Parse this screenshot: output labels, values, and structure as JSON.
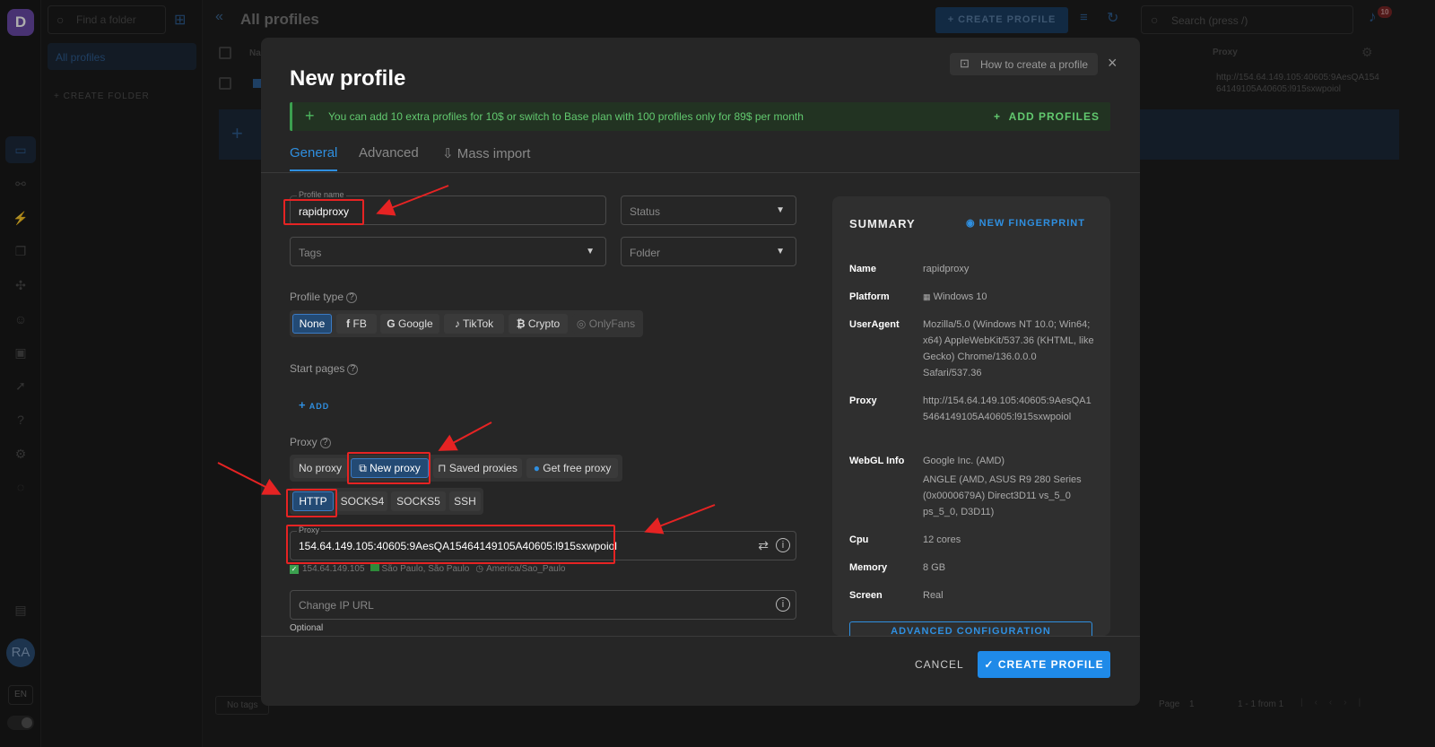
{
  "app": {
    "logo": "D",
    "title": "All profiles",
    "back_icon": "double-chevron-left-icon"
  },
  "rail": {
    "avatar": "RA",
    "language": "EN",
    "icons": [
      "profiles-icon",
      "link-icon",
      "automation-icon",
      "copy-icon",
      "extensions-icon",
      "team-icon",
      "api-icon",
      "launch-icon",
      "help-icon",
      "settings-icon",
      "bulb-icon",
      "wallet-icon",
      "theme-toggle-icon"
    ]
  },
  "folders": {
    "search_placeholder": "Find a folder",
    "all_profiles": "All profiles",
    "create_folder": "+ CREATE FOLDER"
  },
  "topbar": {
    "create_profile": "+ CREATE PROFILE",
    "search_placeholder": "Search (press /)",
    "notifications": "10"
  },
  "table": {
    "col_name": "Na",
    "col_proxy": "Proxy",
    "row_proxy": "http://154.64.149.105:40605:9AesQA15464149105A40605:l915sxwpoiol",
    "footer": {
      "no_tags": "No tags",
      "page_label": "Page",
      "page": "1",
      "range": "1 - 1 from 1"
    }
  },
  "modal": {
    "title": "New profile",
    "how_to": "How to create a profile",
    "banner": {
      "text": "You can add 10 extra profiles for 10$ or switch to Base plan with 100 profiles only for 89$ per month",
      "action": "ADD PROFILES"
    },
    "tabs": [
      "General",
      "Advanced",
      "Mass import"
    ],
    "fields": {
      "profile_name_label": "Profile name",
      "profile_name": "rapidproxy",
      "status": "Status",
      "tags": "Tags",
      "folder": "Folder"
    },
    "profile_type": {
      "label": "Profile type",
      "options": [
        "None",
        "FB",
        "Google",
        "TikTok",
        "Crypto",
        "OnlyFans"
      ],
      "selected": "None"
    },
    "start_pages": {
      "label": "Start pages",
      "add": "ADD"
    },
    "proxy": {
      "label": "Proxy",
      "modes": [
        "No proxy",
        "New proxy",
        "Saved proxies",
        "Get free proxy"
      ],
      "selected_mode": "New proxy",
      "protocols": [
        "HTTP",
        "SOCKS4",
        "SOCKS5",
        "SSH"
      ],
      "selected_protocol": "HTTP",
      "input_label": "Proxy",
      "value": "154.64.149.105:40605:9AesQA15464149105A40605:l915sxwpoiol",
      "ip": "154.64.149.105",
      "location": "São Paulo, São Paulo",
      "timezone": "America/Sao_Paulo",
      "change_ip_placeholder": "Change IP URL",
      "optional": "Optional"
    },
    "summary": {
      "title": "SUMMARY",
      "new_fingerprint": "NEW FINGERPRINT",
      "rows": [
        {
          "k": "Name",
          "v": "rapidproxy"
        },
        {
          "k": "Platform",
          "v": "Windows 10"
        },
        {
          "k": "UserAgent",
          "v": "Mozilla/5.0 (Windows NT 10.0; Win64; x64) AppleWebKit/537.36 (KHTML, like Gecko) Chrome/136.0.0.0 Safari/537.36"
        },
        {
          "k": "Proxy",
          "v": "http://154.64.149.105:40605:9AesQA15464149105A40605:l915sxwpoiol"
        },
        {
          "k": "WebGL Info",
          "v": "Google Inc. (AMD)"
        },
        {
          "k": "",
          "v": "ANGLE (AMD, ASUS R9 280 Series (0x0000679A) Direct3D11 vs_5_0 ps_5_0, D3D11)"
        },
        {
          "k": "Cpu",
          "v": "12 cores"
        },
        {
          "k": "Memory",
          "v": "8 GB"
        },
        {
          "k": "Screen",
          "v": "Real"
        }
      ],
      "advanced_config": "ADVANCED CONFIGURATION"
    },
    "footer": {
      "cancel": "CANCEL",
      "create": "CREATE PROFILE"
    }
  },
  "colors": {
    "accent": "#2f8fe0",
    "highlight": "#e62323",
    "banner": "#62c96f"
  }
}
